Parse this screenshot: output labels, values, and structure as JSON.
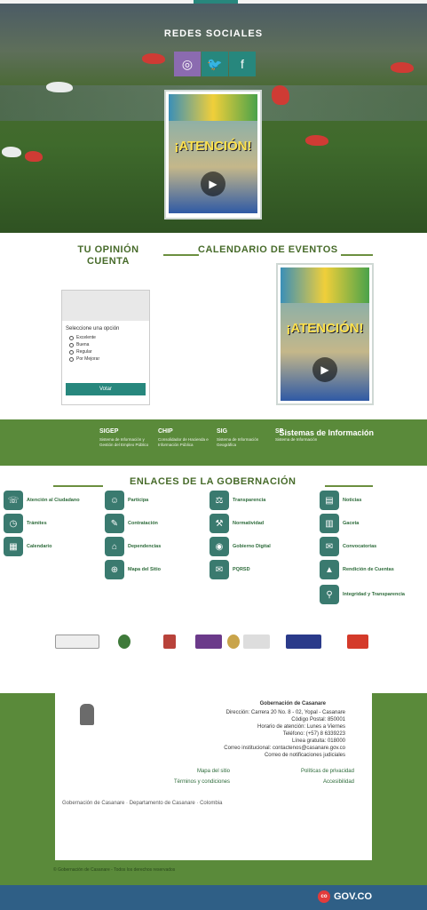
{
  "social": {
    "title": "REDES SOCIALES",
    "icons": [
      "instagram-icon",
      "twitter-icon",
      "facebook-icon"
    ],
    "glyphs": [
      "◎",
      "🐦",
      "f"
    ]
  },
  "video": {
    "title": "¡ATENCIÓN!"
  },
  "middle": {
    "calendar_title": "CALENDARIO DE EVENTOS",
    "opinion_title": "TU OPINIÓN CUENTA",
    "poll": {
      "question": "Seleccione una opción",
      "options": [
        "Excelente",
        "Buena",
        "Regular",
        "Por Mejorar"
      ],
      "vote_label": "Votar"
    }
  },
  "band": {
    "systems_title": "Sistemas de Información",
    "items": [
      {
        "label": "SIGEP",
        "desc": "Sistema de Información y Gestión del Empleo Público"
      },
      {
        "label": "CHIP",
        "desc": "Consolidador de Hacienda e Información Pública"
      },
      {
        "label": "SIG",
        "desc": "Sistema de Información Geográfica"
      },
      {
        "label": "SP",
        "desc": "Sistema de Información"
      }
    ]
  },
  "links": {
    "title": "ENLACES DE LA GOBERNACIÓN",
    "items": [
      {
        "label": "Noticias",
        "icon": "newspaper-icon",
        "glyph": "▤"
      },
      {
        "label": "Transparencia",
        "icon": "scale-icon",
        "glyph": "⚖"
      },
      {
        "label": "Participa",
        "icon": "people-icon",
        "glyph": "☺"
      },
      {
        "label": "Atención al Ciudadano",
        "icon": "headset-icon",
        "glyph": "☏"
      },
      {
        "label": "Gaceta",
        "icon": "book-icon",
        "glyph": "▥"
      },
      {
        "label": "Normatividad",
        "icon": "gavel-icon",
        "glyph": "⚒"
      },
      {
        "label": "Contratación",
        "icon": "document-icon",
        "glyph": "✎"
      },
      {
        "label": "Trámites",
        "icon": "clock-icon",
        "glyph": "◷"
      },
      {
        "label": "Convocatorias",
        "icon": "megaphone-icon",
        "glyph": "✉"
      },
      {
        "label": "Gobierno Digital",
        "icon": "globe-icon",
        "glyph": "◉"
      },
      {
        "label": "Dependencias",
        "icon": "building-icon",
        "glyph": "⌂"
      },
      {
        "label": "Calendario",
        "icon": "calendar-icon",
        "glyph": "▦"
      },
      {
        "label": "Rendición de Cuentas",
        "icon": "chart-icon",
        "glyph": "▲"
      },
      {
        "label": "PQRSD",
        "icon": "mail-icon",
        "glyph": "✉"
      },
      {
        "label": "Mapa del Sitio",
        "icon": "map-icon",
        "glyph": "⊕"
      },
      {
        "label": "Integridad y Transparencia",
        "icon": "search-icon",
        "glyph": "⚲"
      }
    ]
  },
  "footer": {
    "entity": "Gobernación de Casanare",
    "lines": [
      "Dirección: Carrera 20 No. 8 - 02, Yopal - Casanare",
      "Código Postal: 850001",
      "Horario de atención: Lunes a Viernes",
      "Teléfono: (+57) 8 6339223",
      "Línea gratuita: 018000",
      "Correo institucional: contactenos@casanare.gov.co",
      "Correo de notificaciones judiciales"
    ],
    "links": [
      "Políticas de privacidad",
      "Mapa del sitio",
      "Accesibilidad",
      "Términos y condiciones"
    ],
    "copyright": "© Gobernación de Casanare - Todos los derechos reservados",
    "gov_label": "GOV.CO"
  }
}
